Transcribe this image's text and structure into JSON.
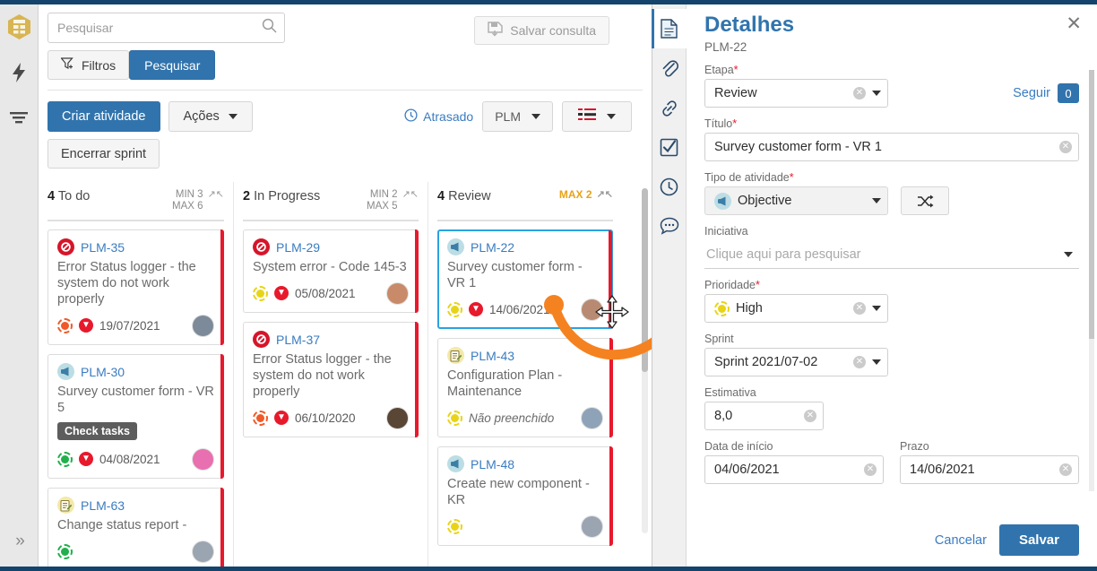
{
  "colors": {
    "accent": "#3174ad",
    "danger": "#e8192c",
    "warn": "#e8a317",
    "annotation": "#f58220",
    "selected_border": "#29a3e0",
    "topbar": "#14436b"
  },
  "left_sidebar": {
    "items": [
      {
        "name": "app-logo",
        "icon": "hexagon-logo-icon"
      },
      {
        "name": "automation",
        "icon": "lightning-bolt-icon"
      },
      {
        "name": "filters",
        "icon": "filter-lines-icon"
      }
    ],
    "expand_label": "»"
  },
  "search": {
    "placeholder": "Pesquisar",
    "value": "",
    "icon": "search-icon",
    "filters_label": "Filtros",
    "filters_icon": "filter-add-icon",
    "search_button": "Pesquisar",
    "save_query_label": "Salvar consulta",
    "save_query_icon": "save-disk-icon"
  },
  "toolbar": {
    "create_label": "Criar atividade",
    "actions_label": "Ações",
    "close_sprint_label": "Encerrar sprint",
    "late_label": "Atrasado",
    "late_icon": "clock-icon",
    "project_selector": "PLM",
    "view_selector_icon": "list-view-icon"
  },
  "board": {
    "columns": [
      {
        "count": "4",
        "title": "To do",
        "min": "MIN 3",
        "max": "MAX 6",
        "limit_warn": false,
        "cards": [
          {
            "key": "PLM-35",
            "type_icon": "blocked-icon",
            "type": "block",
            "title": "Error Status logger - the system do not work properly",
            "priority_color": "#f05a28",
            "date": "19/07/2021",
            "avatar_color": "#7d8a99",
            "tag": null,
            "selected": false
          },
          {
            "key": "PLM-30",
            "type_icon": "objective-megaphone-icon",
            "type": "obj",
            "title": "Survey customer form - VR 5",
            "priority_color": "#21b04b",
            "date": "04/08/2021",
            "avatar_color": "#e86fb0",
            "tag": "Check tasks",
            "selected": false
          },
          {
            "key": "PLM-63",
            "type_icon": "document-task-icon",
            "type": "doc",
            "title": "Change status report -",
            "priority_color": "#21b04b",
            "date": "",
            "avatar_color": "#9aa5b1",
            "tag": null,
            "selected": false
          }
        ]
      },
      {
        "count": "2",
        "title": "In Progress",
        "min": "MIN 2",
        "max": "MAX 5",
        "limit_warn": false,
        "cards": [
          {
            "key": "PLM-29",
            "type_icon": "blocked-icon",
            "type": "block",
            "title": "System error - Code 145-3",
            "priority_color": "#e8d417",
            "date": "05/08/2021",
            "avatar_color": "#c98a6a",
            "tag": null,
            "selected": false
          },
          {
            "key": "PLM-37",
            "type_icon": "blocked-icon",
            "type": "block",
            "title": "Error Status logger - the system do not work properly",
            "priority_color": "#f05a28",
            "date": "06/10/2020",
            "avatar_color": "#5a4634",
            "tag": null,
            "selected": false
          }
        ]
      },
      {
        "count": "4",
        "title": "Review",
        "min": "",
        "max": "MAX 2",
        "limit_warn": true,
        "cards": [
          {
            "key": "PLM-22",
            "type_icon": "objective-megaphone-icon",
            "type": "obj",
            "title": "Survey customer form - VR 1",
            "priority_color": "#e8d417",
            "date": "14/06/2021",
            "avatar_color": "#b98a72",
            "tag": null,
            "selected": true
          },
          {
            "key": "PLM-43",
            "type_icon": "document-task-icon",
            "type": "doc",
            "title": "Configuration Plan - Maintenance",
            "priority_color": "#e8d417",
            "date": "Não preenchido",
            "date_empty": true,
            "avatar_color": "#8fa3b8",
            "tag": null,
            "selected": false
          },
          {
            "key": "PLM-48",
            "type_icon": "objective-megaphone-icon",
            "type": "obj",
            "title": "Create new component - KR",
            "priority_color": "#e8d417",
            "date": "",
            "avatar_color": "#9aa5b1",
            "tag": null,
            "selected": false
          }
        ]
      }
    ]
  },
  "details": {
    "rail_icons": [
      "document-icon",
      "paperclip-icon",
      "link-icon",
      "checkbox-icon",
      "clock-icon",
      "comment-icon"
    ],
    "title": "Detalhes",
    "subtitle": "PLM-22",
    "close_icon": "close-icon",
    "follow_label": "Seguir",
    "follow_count": "0",
    "fields": {
      "etapa_label": "Etapa",
      "etapa_value": "Review",
      "titulo_label": "Título",
      "titulo_value": "Survey customer form - VR 1",
      "tipo_label": "Tipo de atividade",
      "tipo_value": "Objective",
      "shuffle_icon": "shuffle-icon",
      "iniciativa_label": "Iniciativa",
      "iniciativa_placeholder": "Clique aqui para pesquisar",
      "prioridade_label": "Prioridade",
      "prioridade_value": "High",
      "prioridade_color": "#e8d417",
      "sprint_label": "Sprint",
      "sprint_value": "Sprint 2021/07-02",
      "estimativa_label": "Estimativa",
      "estimativa_value": "8,0",
      "inicio_label": "Data de início",
      "inicio_value": "04/06/2021",
      "prazo_label": "Prazo",
      "prazo_value": "14/06/2021"
    },
    "cancel_label": "Cancelar",
    "save_label": "Salvar"
  },
  "annotation": {
    "arrow_color": "#f58220",
    "cursor_icon": "move-cursor-icon"
  }
}
